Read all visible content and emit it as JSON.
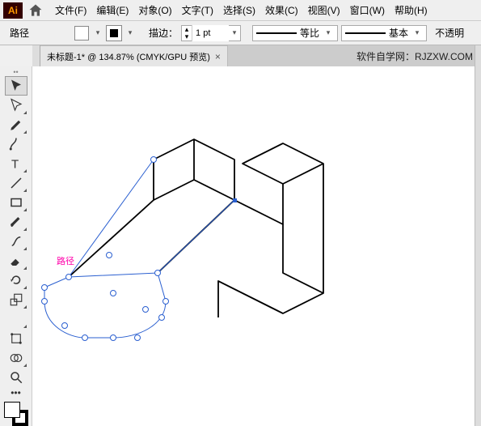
{
  "menu": {
    "items": [
      "文件(F)",
      "编辑(E)",
      "对象(O)",
      "文字(T)",
      "选择(S)",
      "效果(C)",
      "视图(V)",
      "窗口(W)",
      "帮助(H)"
    ]
  },
  "control": {
    "selection_label": "路径",
    "stroke_label": "描边：",
    "stroke_value": "1 pt",
    "profile_label": "等比",
    "brush_label": "基本",
    "opacity_label": "不透明"
  },
  "tab": {
    "title": "未标题-1* @ 134.87% (CMYK/GPU 预览)",
    "site": "软件自学网：RJZXW.COM"
  },
  "canvas": {
    "path_tag": "路径"
  },
  "logo": "Ai"
}
